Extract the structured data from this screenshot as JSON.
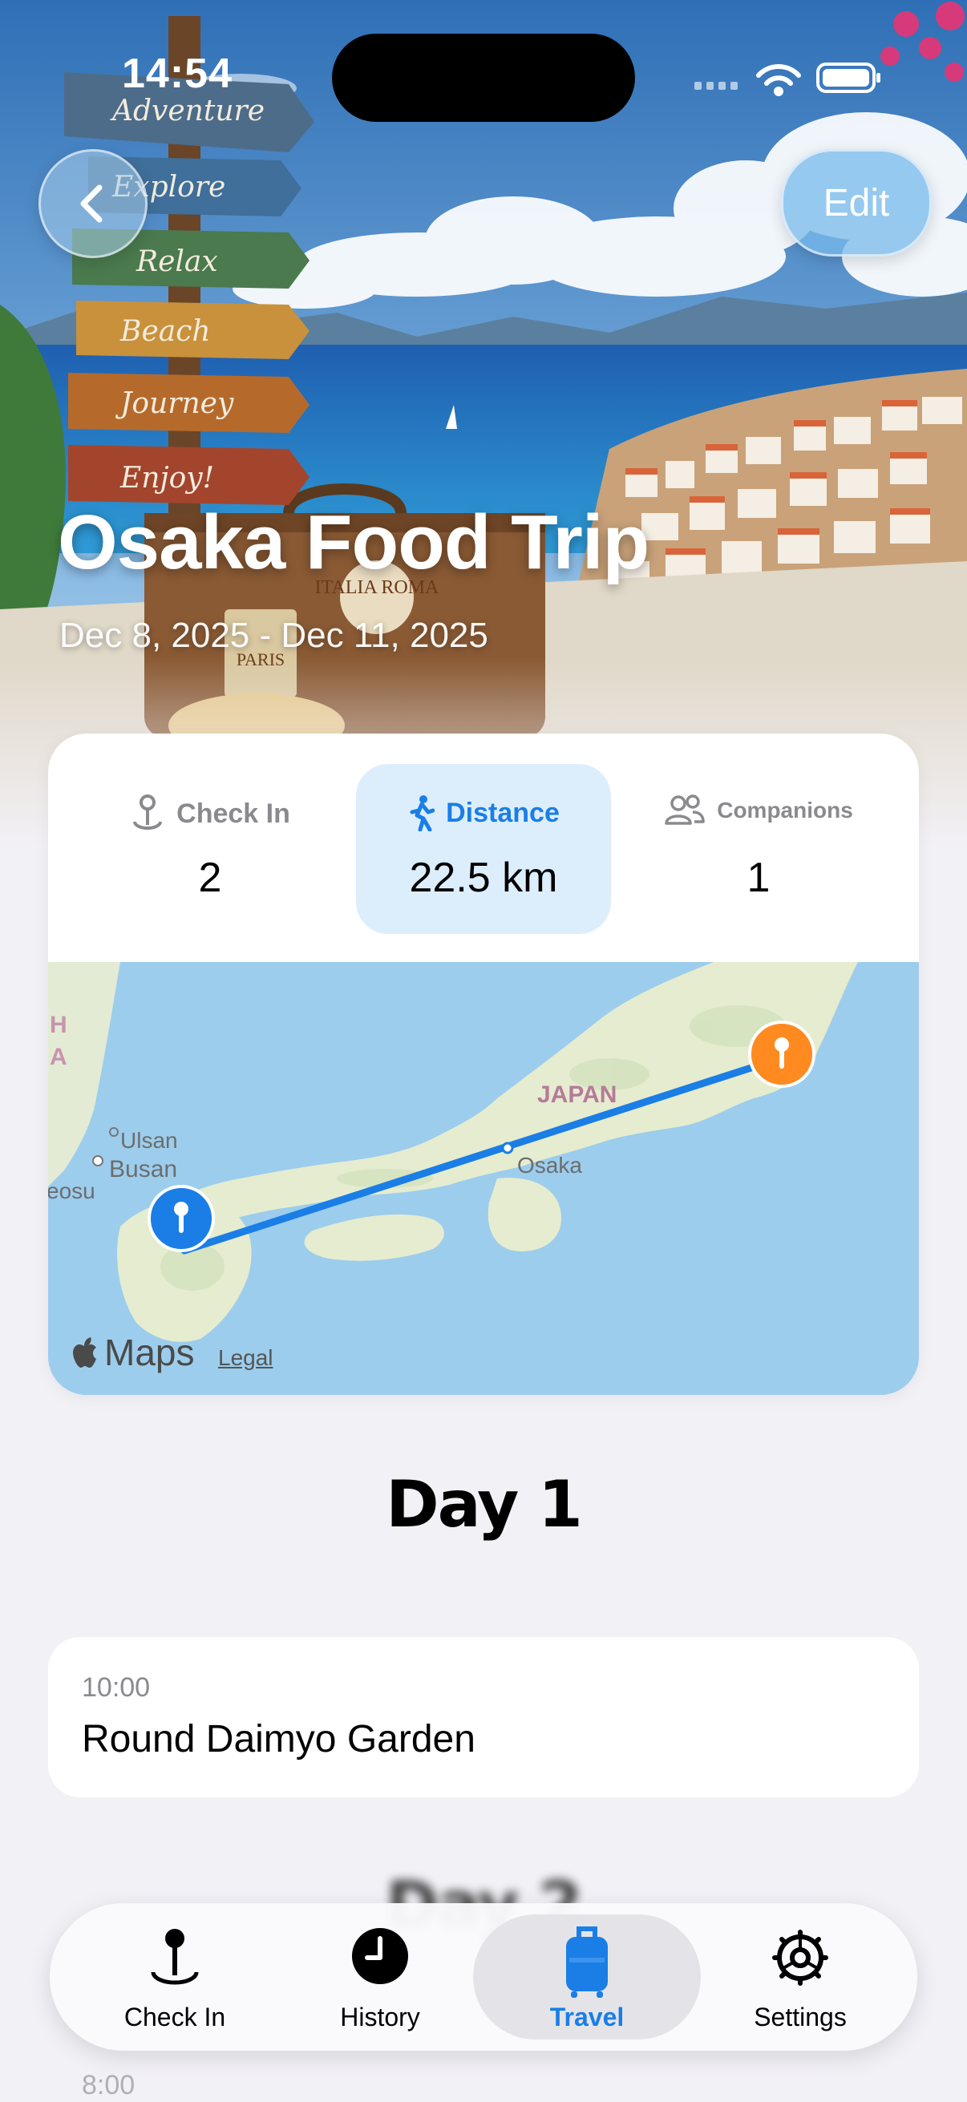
{
  "status": {
    "time": "14:54"
  },
  "nav": {
    "edit_label": "Edit"
  },
  "hero": {
    "title": "Osaka Food Trip",
    "dates": "Dec 8, 2025 - Dec 11, 2025",
    "signposts": [
      "Adventure",
      "Explore",
      "Relax",
      "Beach",
      "Journey",
      "Enjoy!"
    ],
    "suitcase_stickers": [
      "ITALIA ROMA",
      "PARIS"
    ]
  },
  "stats": [
    {
      "label": "Check In",
      "value": "2",
      "icon": "check-in-pin-icon",
      "selected": false
    },
    {
      "label": "Distance",
      "value": "22.5 km",
      "icon": "walking-figure-icon",
      "selected": true
    },
    {
      "label": "Companions",
      "value": "1",
      "icon": "two-people-icon",
      "selected": false
    }
  ],
  "map": {
    "labels": {
      "country": "JAPAN",
      "city_osaka": "Osaka",
      "city_ulsan": "Ulsan",
      "city_busan": "Busan",
      "edge_seoul": "eosu",
      "edge_h": "H",
      "edge_a": "A"
    },
    "brand": "Maps",
    "legal": "Legal",
    "route_color": "#1a7ee6",
    "start_pin_color": "#1a7ee6",
    "end_pin_color": "#ff8a1f"
  },
  "days": [
    {
      "heading": "Day 1",
      "entries": [
        {
          "time": "10:00",
          "title": "Round Daimyo Garden"
        }
      ]
    },
    {
      "heading": "Day 2",
      "entries": [
        {
          "time": "8:00"
        }
      ]
    }
  ],
  "tabbar": {
    "items": [
      {
        "label": "Check In",
        "icon": "check-in-pin-icon"
      },
      {
        "label": "History",
        "icon": "clock-icon"
      },
      {
        "label": "Travel",
        "icon": "suitcase-icon",
        "active": true
      },
      {
        "label": "Settings",
        "icon": "gear-icon"
      }
    ],
    "accent": "#1a7ee6"
  }
}
